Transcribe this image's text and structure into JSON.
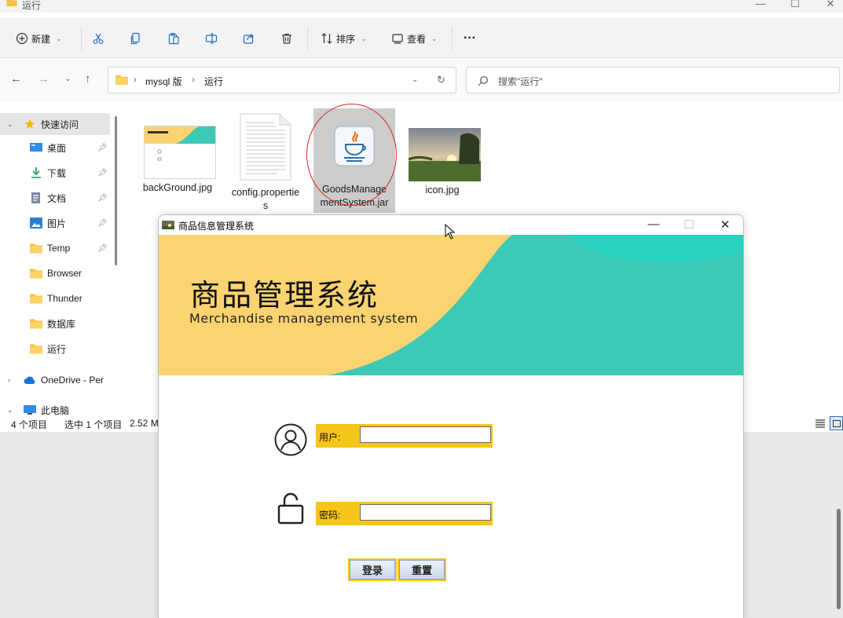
{
  "explorer": {
    "title": "运行",
    "toolbar": {
      "new_label": "新建",
      "sort_label": "排序",
      "view_label": "查看",
      "more_label": "···"
    },
    "address": {
      "crumbs": [
        "mysql 版",
        "运行"
      ],
      "search_placeholder": "搜索\"运行\""
    },
    "sidebar": {
      "quick_access": "快速访问",
      "items": [
        {
          "label": "桌面",
          "pinned": true,
          "icon": "desktop-icon"
        },
        {
          "label": "下载",
          "pinned": true,
          "icon": "download-icon"
        },
        {
          "label": "文档",
          "pinned": true,
          "icon": "document-icon"
        },
        {
          "label": "图片",
          "pinned": true,
          "icon": "picture-icon"
        },
        {
          "label": "Temp",
          "pinned": true,
          "icon": "folder-icon"
        },
        {
          "label": "Browser",
          "pinned": false,
          "icon": "folder-icon"
        },
        {
          "label": "Thunder",
          "pinned": false,
          "icon": "folder-icon"
        },
        {
          "label": "数据库",
          "pinned": false,
          "icon": "folder-icon"
        },
        {
          "label": "运行",
          "pinned": false,
          "icon": "folder-icon"
        }
      ],
      "onedrive": "OneDrive - Per",
      "this_pc": "此电脑"
    },
    "files": [
      {
        "name": "backGround.jpg",
        "icon": "image-thumbnail-icon"
      },
      {
        "name": "config.properties",
        "icon": "text-file-icon"
      },
      {
        "name": "GoodsManagementSystem.jar",
        "icon": "java-jar-icon",
        "selected": true
      },
      {
        "name": "icon.jpg",
        "icon": "photo-thumbnail-icon"
      }
    ],
    "status": {
      "count": "4 个项目",
      "selected": "选中 1 个项目",
      "size": "2.52 M"
    }
  },
  "dialog": {
    "title": "商品信息管理系统",
    "banner_title": "商品管理系统",
    "banner_subtitle": "Merchandise management system",
    "user_label": "用户:",
    "user_value": "",
    "password_label": "密码:",
    "password_value": "",
    "login_button": "登录",
    "reset_button": "重置"
  },
  "colors": {
    "banner_yellow": "#fbd370",
    "banner_teal": "#3cc9b6",
    "field_gold": "#f5c518",
    "annotation_red": "#e02020"
  }
}
